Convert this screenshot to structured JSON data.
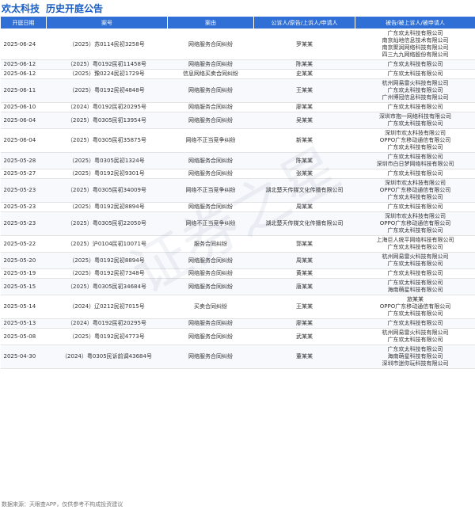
{
  "header": {
    "company": "欢太科技",
    "section": "历史开庭公告"
  },
  "table": {
    "columns": [
      "开庭日期",
      "案号",
      "案由",
      "公诉人/原告/上诉人/申请人",
      "被告/被上诉人/被申请人"
    ],
    "rows": [
      {
        "date": "2025-06-24",
        "case_no": "（2025）苏0114民初3258号",
        "cause": "网络服务合同纠纷",
        "plaintiff": "罗某某",
        "defendants": [
          "广东欢太科技有限公司",
          "南京灿地信息技术有限公司",
          "南京聚润网络科技有限公司",
          "四三九九网络股份有限公司"
        ]
      },
      {
        "date": "2025-06-12",
        "case_no": "（2025）粤0192民初11458号",
        "cause": "网络服务合同纠纷",
        "plaintiff": "陈某某",
        "defendants": [
          "广东欢太科技有限公司"
        ]
      },
      {
        "date": "2025-06-12",
        "case_no": "（2025）豫0224民初1729号",
        "cause": "信息网络买卖合同纠纷",
        "plaintiff": "史某某",
        "defendants": [
          "广东欢太科技有限公司"
        ]
      },
      {
        "date": "2025-06-11",
        "case_no": "（2025）粤0192民初4848号",
        "cause": "网络服务合同纠纷",
        "plaintiff": "王某某",
        "defendants": [
          "杭州网易雷火科技有限公司",
          "广东欢太科技有限公司",
          "广州博冠信息科技有限公司"
        ]
      },
      {
        "date": "2025-06-10",
        "case_no": "（2024）粤0192民初20295号",
        "cause": "网络服务合同纠纷",
        "plaintiff": "廖某某",
        "defendants": [
          "广东欢太科技有限公司"
        ]
      },
      {
        "date": "2025-06-04",
        "case_no": "（2025）粤0305民初13954号",
        "cause": "网络服务合同纠纷",
        "plaintiff": "吴某某",
        "defendants": [
          "深圳市抱一网络科技有限公司",
          "广东欢太科技有限公司"
        ]
      },
      {
        "date": "2025-06-04",
        "case_no": "（2025）粤0305民初35875号",
        "cause": "网络不正当竞争纠纷",
        "plaintiff": "新某某",
        "defendants": [
          "深圳市欢太科技有限公司",
          "OPPO广东移动通信有限公司",
          "广东欢太科技有限公司"
        ]
      },
      {
        "date": "2025-05-28",
        "case_no": "（2025）粤0305民初1324号",
        "cause": "网络服务合同纠纷",
        "plaintiff": "陈某某",
        "defendants": [
          "广东欢太科技有限公司",
          "深圳市白日梦网络科技有限公司"
        ]
      },
      {
        "date": "2025-05-27",
        "case_no": "（2025）粤0192民初9301号",
        "cause": "网络服务合同纠纷",
        "plaintiff": "张某某",
        "defendants": [
          "广东欢太科技有限公司"
        ]
      },
      {
        "date": "2025-05-23",
        "case_no": "（2025）粤0305民初34009号",
        "cause": "网络不正当竞争纠纷",
        "plaintiff": "湖北楚天传媒文化传播有限公司",
        "defendants": [
          "深圳市欢太科技有限公司",
          "OPPO广东移动通信有限公司",
          "广东欢太科技有限公司"
        ]
      },
      {
        "date": "2025-05-23",
        "case_no": "（2025）粤0192民初8894号",
        "cause": "网络服务合同纠纷",
        "plaintiff": "周某某",
        "defendants": [
          "广东欢太科技有限公司"
        ]
      },
      {
        "date": "2025-05-23",
        "case_no": "（2025）粤0305民初22050号",
        "cause": "网络不正当竞争纠纷",
        "plaintiff": "湖北楚天传媒文化传播有限公司",
        "defendants": [
          "深圳市欢太科技有限公司",
          "OPPO广东移动通信有限公司",
          "广东欢太科技有限公司"
        ]
      },
      {
        "date": "2025-05-22",
        "case_no": "（2025）沪0104民初10071号",
        "cause": "服务合同纠纷",
        "plaintiff": "郭某某",
        "defendants": [
          "上海巨人统平网络科技有限公司",
          "广东欢太科技有限公司"
        ]
      },
      {
        "date": "2025-05-20",
        "case_no": "（2025）粤0192民初8894号",
        "cause": "网络服务合同纠纷",
        "plaintiff": "周某某",
        "defendants": [
          "杭州网易雷火科技有限公司",
          "广东欢太科技有限公司"
        ]
      },
      {
        "date": "2025-05-19",
        "case_no": "（2025）粤0192民初7348号",
        "cause": "网络服务合同纠纷",
        "plaintiff": "黄某某",
        "defendants": [
          "广东欢太科技有限公司"
        ]
      },
      {
        "date": "2025-05-15",
        "case_no": "（2025）粤0305民初34684号",
        "cause": "网络服务合同纠纷",
        "plaintiff": "唐某某",
        "defendants": [
          "广东欢太科技有限公司",
          "海南萌星科技有限公司"
        ]
      },
      {
        "date": "2025-05-14",
        "case_no": "（2024）辽0212民初7015号",
        "cause": "买卖合同纠纷",
        "plaintiff": "王某某",
        "defendants": [
          "旅某某",
          "OPPO广东移动通信有限公司",
          "广东欢太科技有限公司"
        ]
      },
      {
        "date": "2025-05-13",
        "case_no": "（2024）粤0192民初20295号",
        "cause": "网络服务合同纠纷",
        "plaintiff": "廖某某",
        "defendants": [
          "广东欢太科技有限公司"
        ]
      },
      {
        "date": "2025-05-08",
        "case_no": "（2025）粤0192民初4773号",
        "cause": "网络服务合同纠纷",
        "plaintiff": "武某某",
        "defendants": [
          "杭州网易雷火科技有限公司",
          "广东欢太科技有限公司"
        ]
      },
      {
        "date": "2025-04-30",
        "case_no": "（2024）粤0305民诉前调43684号",
        "cause": "网络服务合同纠纷",
        "plaintiff": "董某某",
        "defendants": [
          "广东欢太科技有限公司",
          "海南萌星科技有限公司",
          "深圳市迷你玩科技有限公司"
        ]
      }
    ]
  },
  "footer": {
    "source": "数据来源：天眼查APP，仅供参考不构成投资建议"
  },
  "watermark": "证券之星",
  "colors": {
    "header_bg": "#2f6fd6",
    "title": "#1a5ec4"
  }
}
